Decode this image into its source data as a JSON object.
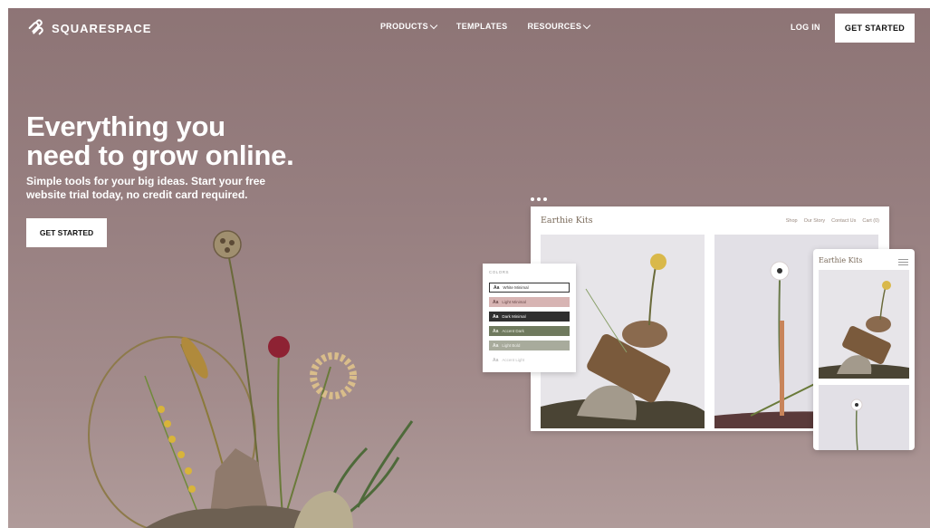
{
  "nav": {
    "logo_text": "SQUARESPACE",
    "items": [
      {
        "label": "PRODUCTS",
        "has_dropdown": true
      },
      {
        "label": "TEMPLATES",
        "has_dropdown": false
      },
      {
        "label": "RESOURCES",
        "has_dropdown": true
      }
    ],
    "login": "LOG IN",
    "cta": "GET STARTED"
  },
  "hero": {
    "title_line1": "Everything you",
    "title_line2": "need to grow online.",
    "subtitle_line1": "Simple tools for your big ideas. Start your free",
    "subtitle_line2": "website trial today, no credit card required.",
    "cta": "GET STARTED"
  },
  "preview": {
    "site_title": "Earthie Kits",
    "site_nav": [
      "Shop",
      "Our Story",
      "Contact Us",
      "Cart (0)"
    ],
    "colors_label": "COLORS",
    "swatches": [
      {
        "glyph": "Aa",
        "name": "White Minimal",
        "bg": "#ffffff",
        "fg": "#333333",
        "border": "#333333"
      },
      {
        "glyph": "Aa",
        "name": "Light Minimal",
        "bg": "#d7b4b3",
        "fg": "#6a4a4a",
        "border": ""
      },
      {
        "glyph": "Aa",
        "name": "Dark Minimal",
        "bg": "#2f2f2f",
        "fg": "#ffffff",
        "border": ""
      },
      {
        "glyph": "Aa",
        "name": "Accent Dark",
        "bg": "#6f7a5e",
        "fg": "#e8eadf",
        "border": ""
      },
      {
        "glyph": "Aa",
        "name": "Light Bold",
        "bg": "#a8ab9c",
        "fg": "#eeeeea",
        "border": ""
      },
      {
        "glyph": "Aa",
        "name": "Accent Light",
        "bg": "#ffffff",
        "fg": "#bbbbbb",
        "border": ""
      }
    ],
    "mobile_title": "Earthie Kits"
  },
  "colors": {
    "background": "#977f80",
    "button_bg": "#ffffff",
    "button_text": "#111111"
  }
}
